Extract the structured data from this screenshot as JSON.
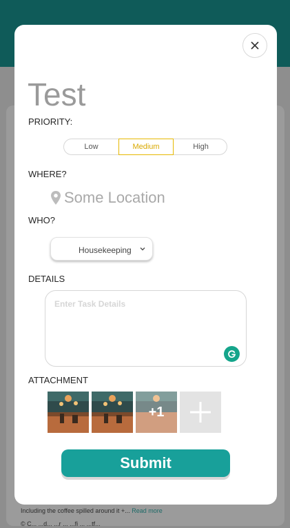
{
  "background": {
    "snippet_text": "Including the coffee spilled around it +...",
    "snippet_link": "Read more",
    "snippet_line2": "© C... ...d... ...r ... ...fi ... ...tf..."
  },
  "modal": {
    "title": "Test",
    "close_icon": "close-icon",
    "priority": {
      "label": "PRIORITY:",
      "options": [
        "Low",
        "Medium",
        "High"
      ],
      "selected": "Medium"
    },
    "where": {
      "label": "WHERE?",
      "placeholder": "Some Location",
      "icon": "location-pin-icon"
    },
    "who": {
      "label": "WHO?",
      "value": "Housekeeping",
      "icon": "chevron-down-icon"
    },
    "details": {
      "label": "DETAILS",
      "placeholder": "Enter Task Details",
      "assistant_icon": "grammarly-icon"
    },
    "attachment": {
      "label": "ATTACHMENT",
      "extra_count": "+1",
      "add_icon": "plus-icon"
    },
    "submit_label": "Submit"
  },
  "colors": {
    "header": "#0f5b59",
    "accent": "#18a09a",
    "selected": "#e6b800",
    "grammarly": "#15a58b"
  }
}
